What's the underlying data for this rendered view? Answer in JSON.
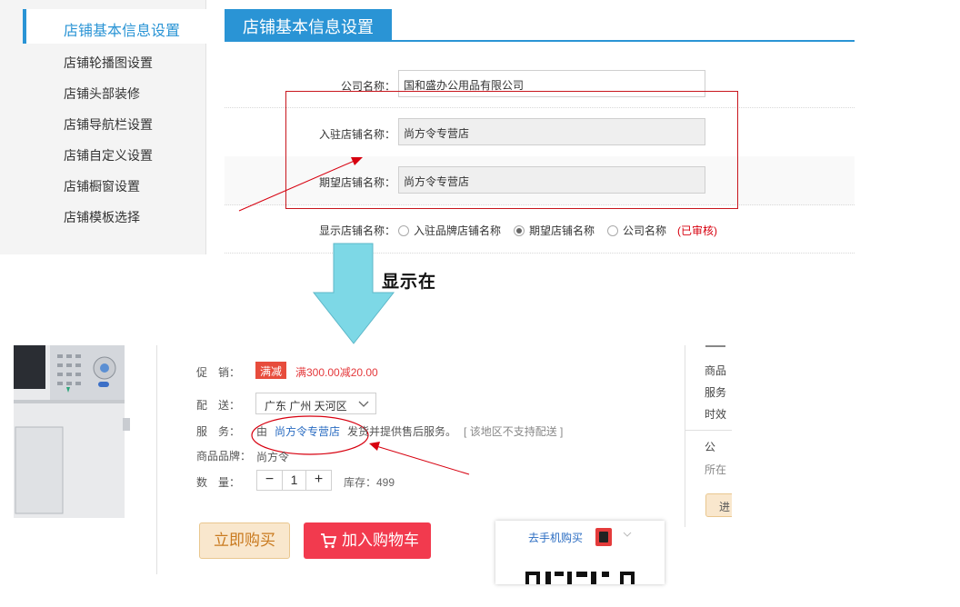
{
  "sidebar": {
    "active_item": "店铺基本信息设置",
    "items": [
      {
        "label": "店铺轮播图设置"
      },
      {
        "label": "店铺头部装修"
      },
      {
        "label": "店铺导航栏设置"
      },
      {
        "label": "店铺自定义设置"
      },
      {
        "label": "店铺橱窗设置"
      },
      {
        "label": "店铺模板选择"
      }
    ]
  },
  "settings": {
    "tab_title": "店铺基本信息设置",
    "company_label": "公司名称：",
    "company_value": "国和盛办公用品有限公司",
    "settle_label": "入驻店铺名称：",
    "settle_value": "尚方令专营店",
    "expect_label": "期望店铺名称：",
    "expect_value": "尚方令专营店",
    "display_label": "显示店铺名称：",
    "display_options": [
      {
        "label": "入驻品牌店铺名称",
        "checked": false
      },
      {
        "label": "期望店铺名称",
        "checked": true
      },
      {
        "label": "公司名称",
        "checked": false
      }
    ],
    "audit_status": "(已审核)"
  },
  "annotation": {
    "arrow_label": "显示在",
    "colors": {
      "red": "#c8161d",
      "arrow_fill": "#7dd8e6",
      "accent": "#2a94d5"
    }
  },
  "product": {
    "promo_label": "促　销：",
    "promo_badge": "满减",
    "promo_text": "满300.00减20.00",
    "delivery_label": "配　送：",
    "delivery_region": "广东 广州 天河区",
    "service_label": "服　务：",
    "service_prefix": "由",
    "service_store": "尚方令专营店",
    "service_suffix": "发货并提供售后服务。",
    "service_note": "[ 该地区不支持配送 ]",
    "brand_label": "商品品牌：",
    "brand_value": "尚方令",
    "qty_label": "数　量：",
    "qty_minus": "−",
    "qty_value": "1",
    "qty_plus": "+",
    "stock": "库存：499",
    "buy_now": "立即购买",
    "add_cart": "加入购物车",
    "mobile_buy": "去手机购买"
  },
  "right_panel": {
    "items": [
      "商品",
      "服务",
      "时效",
      "公",
      "所在"
    ],
    "button": "进"
  }
}
